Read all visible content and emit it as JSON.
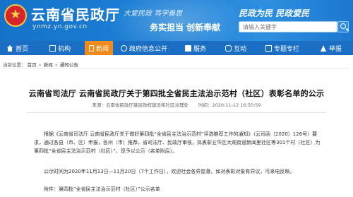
{
  "header": {
    "site_title": "云南省民政厅",
    "domain": "ynmz.yn.gov.cn",
    "slogan_1": "大爱民政 笃学善思",
    "slogan_2": "务实担当 创新奉献",
    "slogan_right": "民政为民 民政爱民",
    "search_placeholder": "请输入关键字"
  },
  "nav": {
    "items": [
      {
        "label": "首页",
        "icon": "home-icon"
      },
      {
        "label": "机构",
        "icon": "org-icon"
      },
      {
        "label": "新闻",
        "icon": "news-icon",
        "active": true
      },
      {
        "label": "政府信息公开",
        "icon": "gov-icon"
      },
      {
        "label": "服务",
        "icon": "service-icon"
      },
      {
        "label": "互动",
        "icon": "chat-icon"
      },
      {
        "label": "专题专栏",
        "icon": "topic-icon"
      },
      {
        "label": "举报",
        "icon": "report-icon"
      }
    ]
  },
  "breadcrumb": {
    "prefix": "当前位置：",
    "items": [
      "首页",
      "新闻",
      "通知公告"
    ],
    "separator": "»"
  },
  "article": {
    "title": "云南省司法厅 云南省民政厅关于第四批全省民主法治示范村（社区）表彰名单的公示",
    "source": "来源：云南省民政厅基层政权建设和社区治理处",
    "published": "时间：2020-11-12 16:50:59",
    "paragraphs": [
      "根据《云南省司法厅 云南省民政厅关于做好第四批“全省民主法治示范村”评选推荐工作的通知》（云司函〔2020〕126号）要求，通过各县（市、区）申报，各州（市）推荐，省司法厅、民政厅审核，拟表彰五华区大观街道新闻里社区等301个村（社区）为第四批“全省民主法治示范村（社区）”，现予以公示（名单附后）。",
      "公示时间为2020年11月13日—11月20日（7个工作日），欢迎社会各界监督。如对表彰对象有异议，可来电反映。",
      "附件：第四批“全省民主法治示范村（社区）”公示名单"
    ]
  },
  "colors": {
    "header_blue": "#1b7fd6",
    "nav_blue": "#1a6fc4",
    "nav_active": "#f08a1a"
  }
}
